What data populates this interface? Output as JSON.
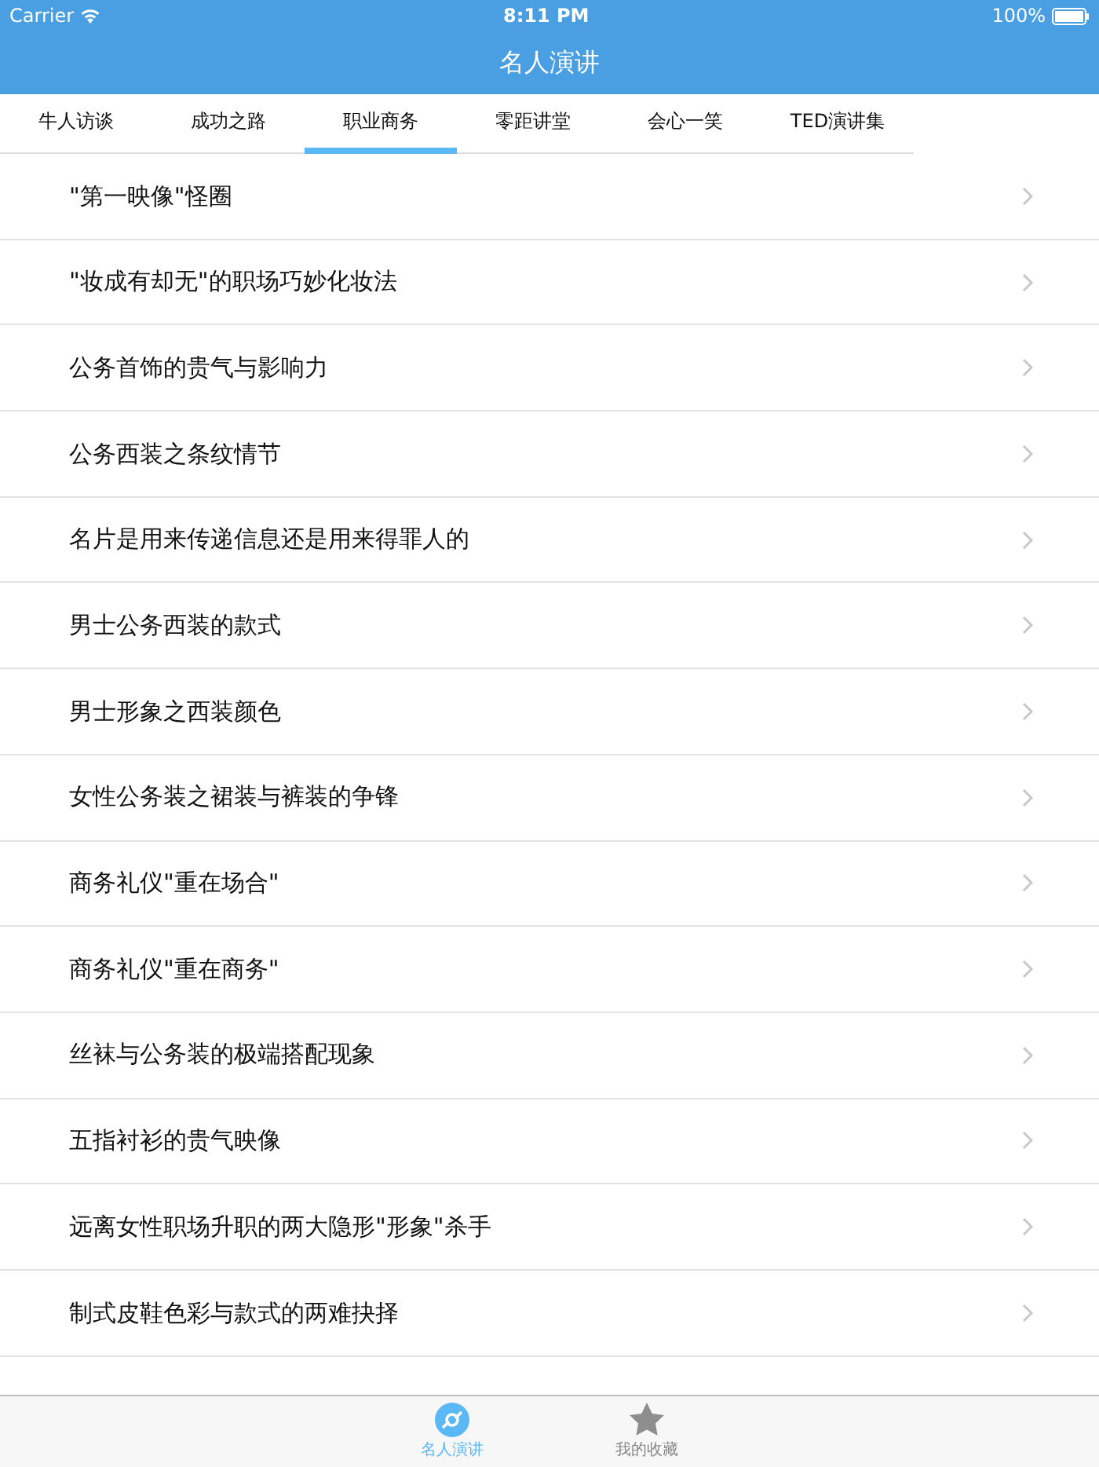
{
  "status_bar": {
    "carrier": "Carrier",
    "time": "8:11 PM",
    "battery": "100%"
  },
  "nav_bar": {
    "title": "名人演讲"
  },
  "tabs": [
    {
      "label": "牛人访谈",
      "selected": false
    },
    {
      "label": "成功之路",
      "selected": false
    },
    {
      "label": "职业商务",
      "selected": true
    },
    {
      "label": "零距讲堂",
      "selected": false
    },
    {
      "label": "会心一笑",
      "selected": false
    },
    {
      "label": "TED演讲集",
      "selected": false
    }
  ],
  "rows": [
    {
      "title": "\"第一映像\"怪圈"
    },
    {
      "title": "\"妆成有却无\"的职场巧妙化妆法"
    },
    {
      "title": "公务首饰的贵气与影响力"
    },
    {
      "title": "公务西装之条纹情节"
    },
    {
      "title": "名片是用来传递信息还是用来得罪人的"
    },
    {
      "title": "男士公务西装的款式"
    },
    {
      "title": "男士形象之西装颜色"
    },
    {
      "title": "女性公务装之裙装与裤装的争锋"
    },
    {
      "title": "商务礼仪\"重在场合\""
    },
    {
      "title": "商务礼仪\"重在商务\""
    },
    {
      "title": "丝袜与公务装的极端搭配现象"
    },
    {
      "title": "五指衬衫的贵气映像"
    },
    {
      "title": "远离女性职场升职的两大隐形\"形象\"杀手"
    },
    {
      "title": "制式皮鞋色彩与款式的两难抉择"
    }
  ],
  "tab_bar": [
    {
      "label": "名人演讲",
      "kind": "disc",
      "selected": true
    },
    {
      "label": "我的收藏",
      "kind": "star",
      "selected": false
    }
  ]
}
